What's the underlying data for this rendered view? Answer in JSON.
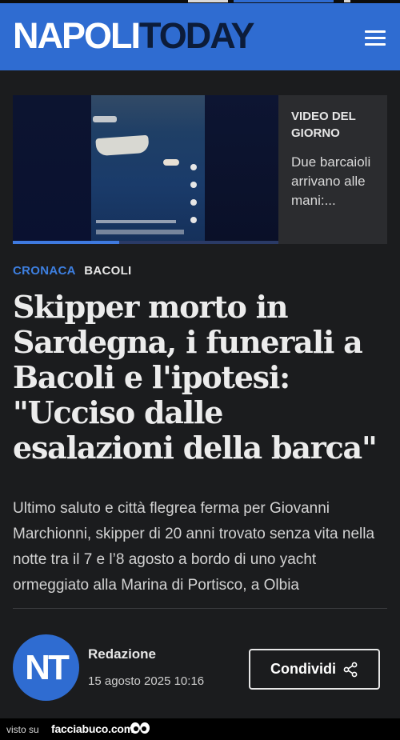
{
  "header": {
    "logo_part1": "NAPOLI",
    "logo_part2": "TODAY",
    "menu_icon": "hamburger-menu-icon",
    "background_color": "#2f6cd1"
  },
  "video": {
    "label": "VIDEO DEL GIORNO",
    "title": "Due barcaioli arrivano alle mani:...",
    "thumbnail_caption": "That's £200 off for a family of four"
  },
  "article": {
    "category": "CRONACA",
    "location": "BACOLI",
    "headline": "Skipper morto in Sardegna, i funerali a Bacoli e l'ipotesi: \"Ucciso dalle esalazioni della barca\"",
    "lead": "Ultimo saluto e città flegrea ferma per Giovanni Marchionni, skipper di 20 anni trovato senza vita nella notte tra il 7 e l’8 agosto a bordo di uno yacht ormeggiato alla Marina di Portisco, a Olbia"
  },
  "byline": {
    "avatar_initials": "NT",
    "author": "Redazione",
    "date": "15 agosto 2025 10:16",
    "share_label": "Condividi",
    "share_icon": "share-icon"
  },
  "footer": {
    "visto_su": "visto su",
    "site": "facciabuco.com",
    "eyes_icon": "googly-eyes-icon"
  },
  "colors": {
    "accent": "#2f6cd1",
    "category": "#3d7fe0",
    "background": "#1b1c1e"
  }
}
